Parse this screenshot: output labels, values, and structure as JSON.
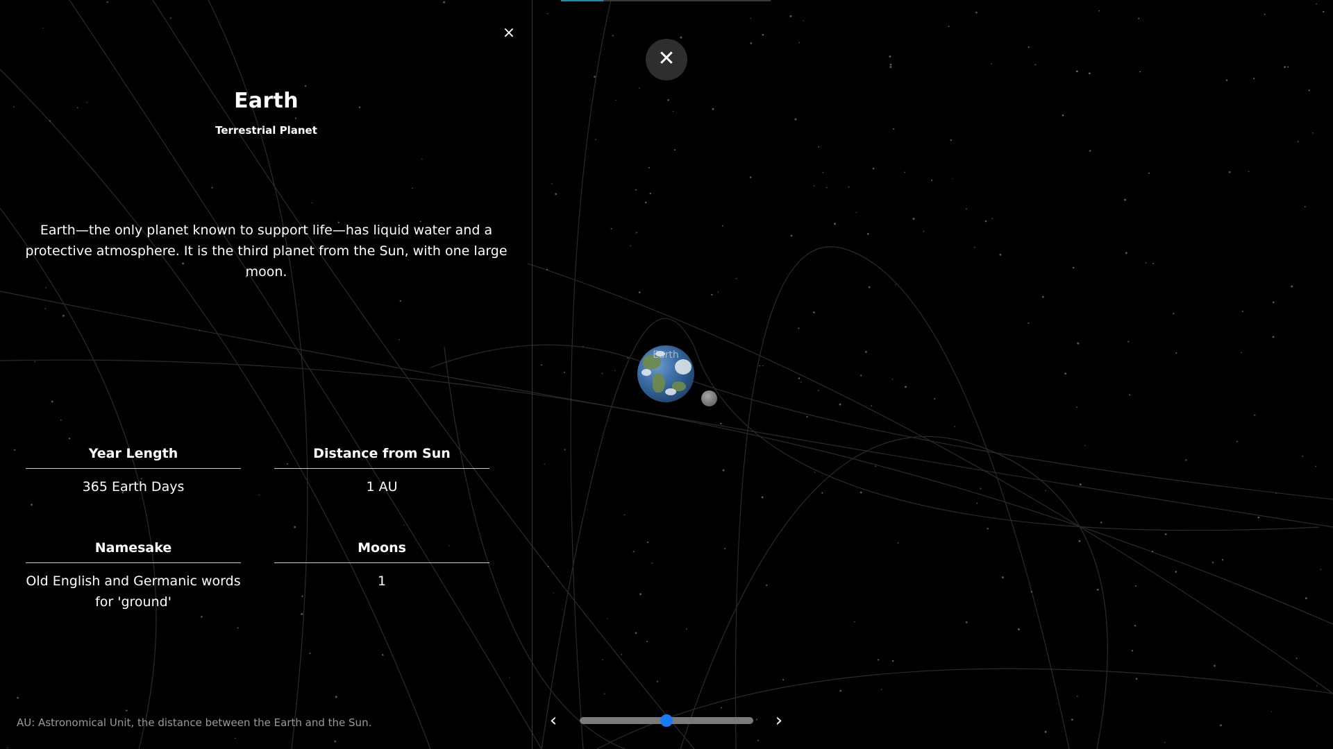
{
  "panel": {
    "close_label": "×",
    "title": "Earth",
    "subtitle": "Terrestrial Planet",
    "description": "Earth—the only planet known to support life—has liquid water and a protective atmosphere. It is the third planet from the Sun, with one large moon.",
    "facts": [
      {
        "label": "Year Length",
        "value": "365 Earth Days"
      },
      {
        "label": "Distance from Sun",
        "value": "1 AU"
      },
      {
        "label": "Namesake",
        "value": "Old English and Germanic words for 'ground'"
      },
      {
        "label": "Moons",
        "value": "1"
      }
    ],
    "footnote": "AU: Astronomical Unit, the distance between the Earth and the Sun."
  },
  "viewport": {
    "close_label": "✕",
    "planet_label": "Earth",
    "timeline": {
      "prev_label": "‹",
      "next_label": "›",
      "position": 0.5
    }
  },
  "colors": {
    "background": "#000000",
    "accent": "#1a7cf4",
    "tab_accent": "#1f8fa6"
  }
}
